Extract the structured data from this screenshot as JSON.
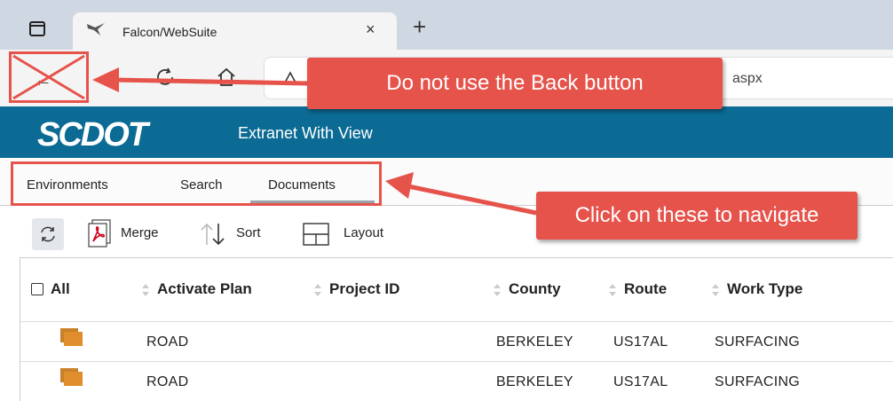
{
  "browser": {
    "tab_title": "Falcon/WebSuite",
    "close_glyph": "×",
    "new_tab_glyph": "+",
    "url_fragment": "aspx",
    "icons": [
      "tab-actions-icon",
      "falcon-favicon-icon",
      "back-arrow-icon",
      "refresh-icon",
      "home-icon",
      "lock-icon"
    ]
  },
  "header": {
    "logo_text": "SCDOT",
    "title": "Extranet With View",
    "color": "#0b6b94"
  },
  "menu": {
    "items": [
      {
        "label": "Environments"
      },
      {
        "label": "Search"
      },
      {
        "label": "Documents"
      }
    ]
  },
  "grid_toolbar": {
    "merge_label": "Merge",
    "sort_label": "Sort",
    "layout_label": "Layout",
    "icons": [
      "sync-icon",
      "pdf-merge-icon",
      "sort-icon",
      "layout-icon"
    ]
  },
  "table": {
    "select_all_label": "All",
    "columns": [
      "Activate Plan",
      "Project ID",
      "County",
      "Route",
      "Work Type"
    ],
    "rows": [
      {
        "activate_plan": "ROAD",
        "project_id": "",
        "county": "BERKELEY",
        "route": "US17AL",
        "work_type": "SURFACING"
      },
      {
        "activate_plan": "ROAD",
        "project_id": "",
        "county": "BERKELEY",
        "route": "US17AL",
        "work_type": "SURFACING"
      }
    ]
  },
  "annotations": {
    "back_callout": "Do not use the Back button",
    "nav_callout": "Click on these to navigate",
    "color": "#e5534b"
  }
}
